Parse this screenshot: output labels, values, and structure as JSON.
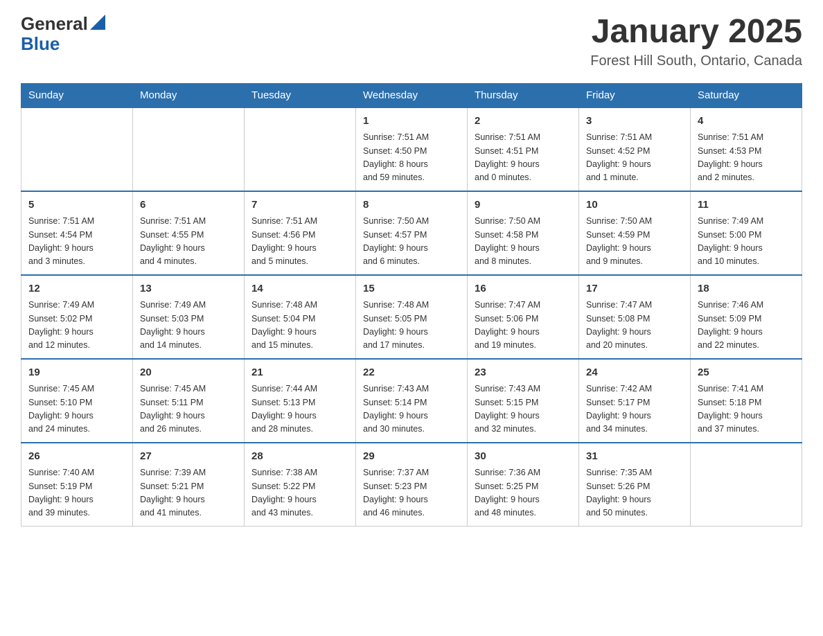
{
  "header": {
    "logo_general": "General",
    "logo_blue": "Blue",
    "month_title": "January 2025",
    "location": "Forest Hill South, Ontario, Canada"
  },
  "days_of_week": [
    "Sunday",
    "Monday",
    "Tuesday",
    "Wednesday",
    "Thursday",
    "Friday",
    "Saturday"
  ],
  "weeks": [
    [
      {
        "day": "",
        "info": ""
      },
      {
        "day": "",
        "info": ""
      },
      {
        "day": "",
        "info": ""
      },
      {
        "day": "1",
        "info": "Sunrise: 7:51 AM\nSunset: 4:50 PM\nDaylight: 8 hours\nand 59 minutes."
      },
      {
        "day": "2",
        "info": "Sunrise: 7:51 AM\nSunset: 4:51 PM\nDaylight: 9 hours\nand 0 minutes."
      },
      {
        "day": "3",
        "info": "Sunrise: 7:51 AM\nSunset: 4:52 PM\nDaylight: 9 hours\nand 1 minute."
      },
      {
        "day": "4",
        "info": "Sunrise: 7:51 AM\nSunset: 4:53 PM\nDaylight: 9 hours\nand 2 minutes."
      }
    ],
    [
      {
        "day": "5",
        "info": "Sunrise: 7:51 AM\nSunset: 4:54 PM\nDaylight: 9 hours\nand 3 minutes."
      },
      {
        "day": "6",
        "info": "Sunrise: 7:51 AM\nSunset: 4:55 PM\nDaylight: 9 hours\nand 4 minutes."
      },
      {
        "day": "7",
        "info": "Sunrise: 7:51 AM\nSunset: 4:56 PM\nDaylight: 9 hours\nand 5 minutes."
      },
      {
        "day": "8",
        "info": "Sunrise: 7:50 AM\nSunset: 4:57 PM\nDaylight: 9 hours\nand 6 minutes."
      },
      {
        "day": "9",
        "info": "Sunrise: 7:50 AM\nSunset: 4:58 PM\nDaylight: 9 hours\nand 8 minutes."
      },
      {
        "day": "10",
        "info": "Sunrise: 7:50 AM\nSunset: 4:59 PM\nDaylight: 9 hours\nand 9 minutes."
      },
      {
        "day": "11",
        "info": "Sunrise: 7:49 AM\nSunset: 5:00 PM\nDaylight: 9 hours\nand 10 minutes."
      }
    ],
    [
      {
        "day": "12",
        "info": "Sunrise: 7:49 AM\nSunset: 5:02 PM\nDaylight: 9 hours\nand 12 minutes."
      },
      {
        "day": "13",
        "info": "Sunrise: 7:49 AM\nSunset: 5:03 PM\nDaylight: 9 hours\nand 14 minutes."
      },
      {
        "day": "14",
        "info": "Sunrise: 7:48 AM\nSunset: 5:04 PM\nDaylight: 9 hours\nand 15 minutes."
      },
      {
        "day": "15",
        "info": "Sunrise: 7:48 AM\nSunset: 5:05 PM\nDaylight: 9 hours\nand 17 minutes."
      },
      {
        "day": "16",
        "info": "Sunrise: 7:47 AM\nSunset: 5:06 PM\nDaylight: 9 hours\nand 19 minutes."
      },
      {
        "day": "17",
        "info": "Sunrise: 7:47 AM\nSunset: 5:08 PM\nDaylight: 9 hours\nand 20 minutes."
      },
      {
        "day": "18",
        "info": "Sunrise: 7:46 AM\nSunset: 5:09 PM\nDaylight: 9 hours\nand 22 minutes."
      }
    ],
    [
      {
        "day": "19",
        "info": "Sunrise: 7:45 AM\nSunset: 5:10 PM\nDaylight: 9 hours\nand 24 minutes."
      },
      {
        "day": "20",
        "info": "Sunrise: 7:45 AM\nSunset: 5:11 PM\nDaylight: 9 hours\nand 26 minutes."
      },
      {
        "day": "21",
        "info": "Sunrise: 7:44 AM\nSunset: 5:13 PM\nDaylight: 9 hours\nand 28 minutes."
      },
      {
        "day": "22",
        "info": "Sunrise: 7:43 AM\nSunset: 5:14 PM\nDaylight: 9 hours\nand 30 minutes."
      },
      {
        "day": "23",
        "info": "Sunrise: 7:43 AM\nSunset: 5:15 PM\nDaylight: 9 hours\nand 32 minutes."
      },
      {
        "day": "24",
        "info": "Sunrise: 7:42 AM\nSunset: 5:17 PM\nDaylight: 9 hours\nand 34 minutes."
      },
      {
        "day": "25",
        "info": "Sunrise: 7:41 AM\nSunset: 5:18 PM\nDaylight: 9 hours\nand 37 minutes."
      }
    ],
    [
      {
        "day": "26",
        "info": "Sunrise: 7:40 AM\nSunset: 5:19 PM\nDaylight: 9 hours\nand 39 minutes."
      },
      {
        "day": "27",
        "info": "Sunrise: 7:39 AM\nSunset: 5:21 PM\nDaylight: 9 hours\nand 41 minutes."
      },
      {
        "day": "28",
        "info": "Sunrise: 7:38 AM\nSunset: 5:22 PM\nDaylight: 9 hours\nand 43 minutes."
      },
      {
        "day": "29",
        "info": "Sunrise: 7:37 AM\nSunset: 5:23 PM\nDaylight: 9 hours\nand 46 minutes."
      },
      {
        "day": "30",
        "info": "Sunrise: 7:36 AM\nSunset: 5:25 PM\nDaylight: 9 hours\nand 48 minutes."
      },
      {
        "day": "31",
        "info": "Sunrise: 7:35 AM\nSunset: 5:26 PM\nDaylight: 9 hours\nand 50 minutes."
      },
      {
        "day": "",
        "info": ""
      }
    ]
  ]
}
